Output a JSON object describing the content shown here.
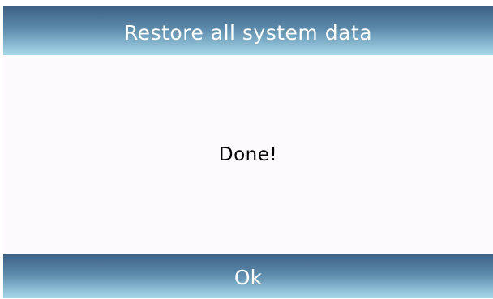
{
  "dialog": {
    "title": "Restore all system data",
    "message": "Done!",
    "ok_label": "Ok"
  },
  "colors": {
    "header_dark": "#3e6285",
    "header_light": "#a7d8e8",
    "body_background": "#fdfafd",
    "text_light": "#ffffff",
    "text_dark": "#000000"
  }
}
